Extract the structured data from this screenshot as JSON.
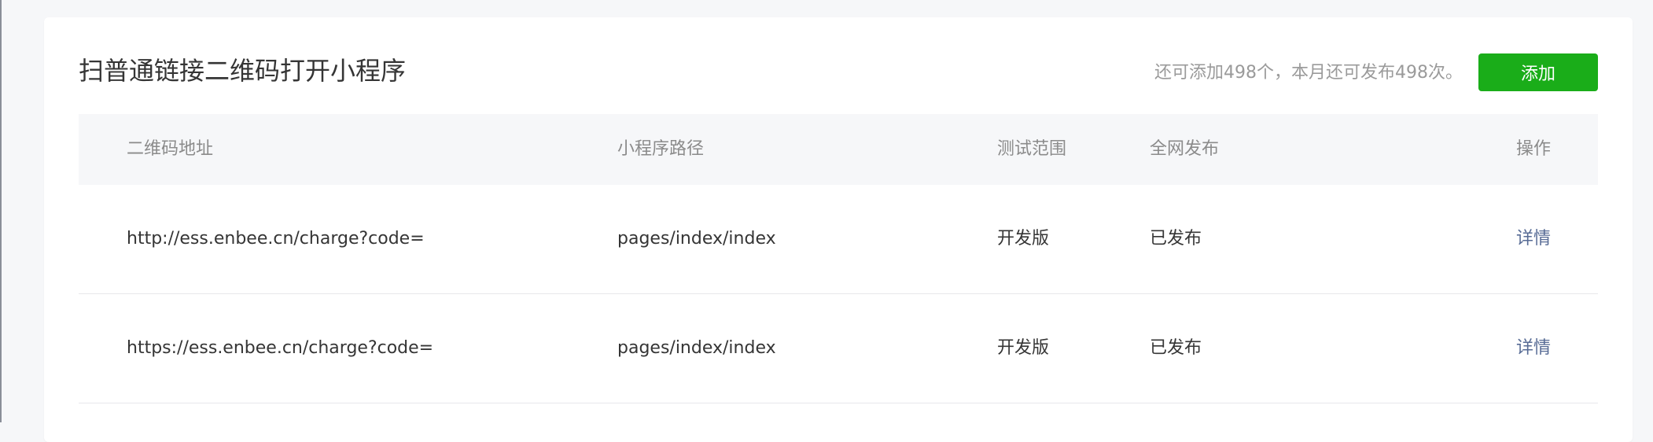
{
  "header": {
    "title": "扫普通链接二维码打开小程序",
    "quota_text": "还可添加498个，本月还可发布498次。",
    "add_label": "添加"
  },
  "table": {
    "columns": [
      "二维码地址",
      "小程序路径",
      "测试范围",
      "全网发布",
      "操作"
    ],
    "rows": [
      {
        "qr_url": "http://ess.enbee.cn/charge?code=",
        "path": "pages/index/index",
        "test_scope": "开发版",
        "publish_status": "已发布",
        "action": "详情"
      },
      {
        "qr_url": "https://ess.enbee.cn/charge?code=",
        "path": "pages/index/index",
        "test_scope": "开发版",
        "publish_status": "已发布",
        "action": "详情"
      }
    ]
  },
  "colors": {
    "primary_button": "#1aad19",
    "link": "#576b95",
    "header_bg": "#f6f7f9"
  }
}
